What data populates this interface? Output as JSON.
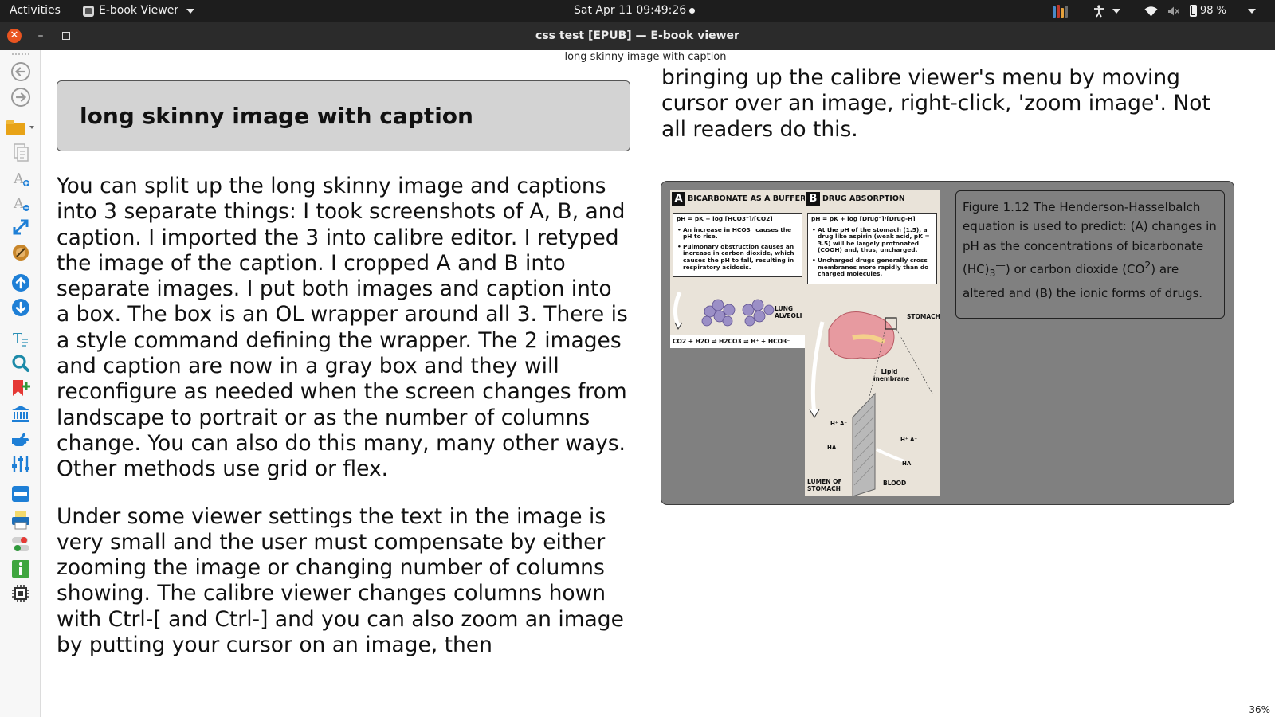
{
  "topbar": {
    "activities": "Activities",
    "app_name": "E-book Viewer",
    "clock": "Sat Apr 11  09:49:26",
    "battery": "98 %"
  },
  "window": {
    "title": "css test [EPUB] — E-book viewer"
  },
  "toolbar": {
    "items": [
      {
        "icon": "back-arrow-icon"
      },
      {
        "icon": "forward-arrow-icon"
      },
      {
        "icon": "open-book-folder-icon"
      },
      {
        "icon": "table-of-contents-icon"
      },
      {
        "icon": "font-size-increase-icon"
      },
      {
        "icon": "font-size-decrease-icon"
      },
      {
        "icon": "fullscreen-icon"
      },
      {
        "icon": "bookmark-tool-icon"
      },
      {
        "icon": "previous-page-icon"
      },
      {
        "icon": "next-page-icon"
      },
      {
        "icon": "lookup-word-icon"
      },
      {
        "icon": "search-icon"
      },
      {
        "icon": "add-bookmark-icon"
      },
      {
        "icon": "reference-mode-icon"
      },
      {
        "icon": "highlight-icon"
      },
      {
        "icon": "preferences-sliders-icon"
      },
      {
        "icon": "toggle-toolbar-icon"
      },
      {
        "icon": "print-icon"
      },
      {
        "icon": "inspector-icon"
      },
      {
        "icon": "info-icon"
      },
      {
        "icon": "chip-icon"
      }
    ]
  },
  "reader": {
    "chapter_header": "long skinny image with caption",
    "heading": "long skinny image with caption",
    "para1": "You can split up the long skinny image and captions into 3 separate things: I took screenshots of A, B, and caption. I imported the 3 into calibre editor. I retyped the image of the caption. I cropped A and B into separate images. I put both images and caption into a box. The box is an OL wrapper around all 3. There is a style command defining the wrapper. The 2 images and caption are now in a gray box and they will reconfigure as needed when the screen changes from landscape to portrait or as the number of columns change. You can also do this many, many other ways. Other methods use grid or flex.",
    "para2": "Under some viewer settings the text in the image is very small and the user must compensate by either zooming the image or changing number of columns showing. The calibre viewer changes columns hown with Ctrl-[ and Ctrl-] and you can also zoom an image by putting your cursor on an image, then",
    "col2_text": "bringing up the calibre viewer's menu by moving cursor over an image, right-click, 'zoom image'. Not all readers do this.",
    "caption_pre": "Figure 1.12 The Henderson-Hasselbalch equation is used to predict: (A) changes in pH as the concentrations of bicarbonate (HC)",
    "caption_sub": "3",
    "caption_sup1": "—",
    "caption_mid": ") or carbon dioxide (CO",
    "caption_sup2": "2",
    "caption_post": ") are altered and (B) the ionic forms of drugs.",
    "progress": "36%"
  },
  "figure_a": {
    "letter": "A",
    "title": "BICARBONATE AS A  BUFFER",
    "equation": "pH = pK + log [HCO3⁻]/[CO2]",
    "bullets": [
      "An increase in HCO3⁻ causes the pH to rise.",
      "Pulmonary obstruction causes an increase in carbon dioxide, which causes the pH to fall, resulting in respiratory acidosis."
    ],
    "label_lung": "LUNG ALVEOLI",
    "reaction": "CO2 + H2O ⇌ H2CO3 ⇌ H⁺ + HCO3⁻"
  },
  "figure_b": {
    "letter": "B",
    "title": "DRUG ABSORPTION",
    "equation": "pH = pK + log [Drug⁻]/[Drug-H]",
    "bullets": [
      "At the pH of the stomach (1.5), a drug like aspirin (weak acid, pK = 3.5) will be largely protonated (COOH) and, thus, uncharged.",
      "Uncharged drugs generally cross membranes more rapidly than do charged molecules."
    ],
    "label_stomach": "STOMACH",
    "label_lipid": "Lipid membrane",
    "label_lumen": "LUMEN OF STOMACH",
    "label_blood": "BLOOD"
  },
  "colors": {
    "topbar": "#1d1d1d",
    "close_button": "#e95420",
    "gray_box": "#808080",
    "heading_box": "#d3d3d3",
    "toolbar_blue": "#1e7fd6"
  }
}
